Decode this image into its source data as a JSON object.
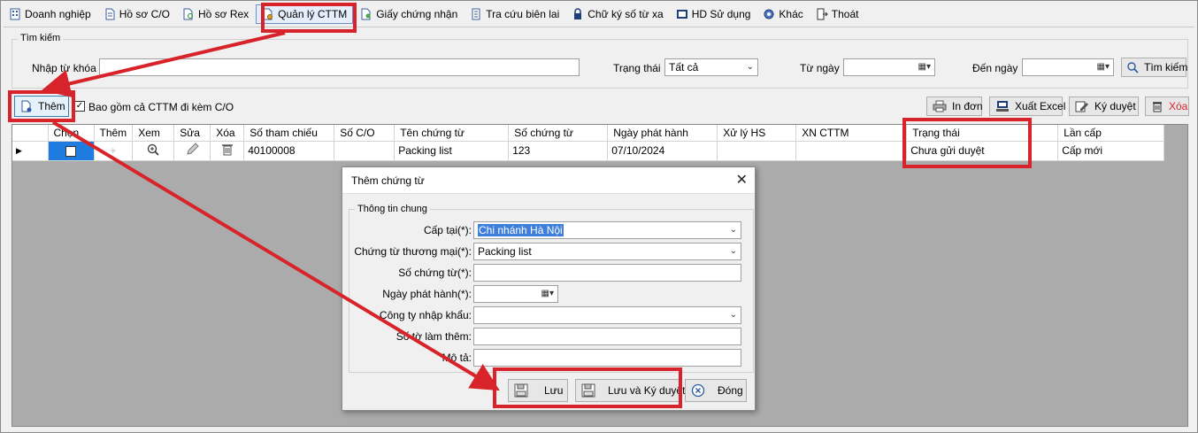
{
  "menu": {
    "items": [
      {
        "label": "Doanh nghiệp",
        "icon": "building-icon"
      },
      {
        "label": "Hồ sơ C/O",
        "icon": "document-icon"
      },
      {
        "label": "Hồ sơ Rex",
        "icon": "document-search-icon"
      },
      {
        "label": "Quản lý CTTM",
        "icon": "document-gear-icon"
      },
      {
        "label": "Giấy chứng nhận",
        "icon": "certificate-icon"
      },
      {
        "label": "Tra cứu biên lai",
        "icon": "receipt-icon"
      },
      {
        "label": "Chữ ký số từ xa",
        "icon": "lock-icon"
      },
      {
        "label": "HD Sử dụng",
        "icon": "help-icon"
      },
      {
        "label": "Khác",
        "icon": "gear-icon"
      },
      {
        "label": "Thoát",
        "icon": "exit-icon"
      }
    ]
  },
  "search": {
    "group_title": "Tìm kiếm",
    "keyword_label": "Nhập từ khóa",
    "keyword_value": "",
    "status_label": "Trạng thái",
    "status_value": "Tất cả",
    "from_label": "Từ ngày",
    "from_value": "",
    "to_label": "Đến ngày",
    "to_value": "",
    "search_button": "Tìm kiếm"
  },
  "toolbar": {
    "add_button": "Thêm",
    "include_checkbox_label": "Bao gồm cả CTTM đi kèm C/O",
    "include_checked": true,
    "print_button": "In đơn",
    "export_button": "Xuất Excel",
    "sign_button": "Ký duyệt",
    "delete_button": "Xóa"
  },
  "grid": {
    "columns": [
      "Chọn",
      "Thêm",
      "Xem",
      "Sửa",
      "Xóa",
      "Số tham chiếu",
      "Số C/O",
      "Tên chứng từ",
      "Số chứng từ",
      "Ngày phát hành",
      "Xử lý HS",
      "XN CTTM",
      "Trạng thái",
      "Lần cấp"
    ],
    "rows": [
      {
        "ref_no": "40100008",
        "co_no": "",
        "doc_name": "Packing list",
        "doc_no": "123",
        "issue_date": "07/10/2024",
        "processing": "",
        "confirm": "",
        "status": "Chưa gửi duyệt",
        "issue_count": "Cấp mới"
      }
    ]
  },
  "dialog": {
    "title": "Thêm chứng từ",
    "group_title": "Thông tin chung",
    "fields": {
      "issued_at_label": "Cấp tại(*):",
      "issued_at_value": "Chi nhánh Hà Nội",
      "commercial_doc_label": "Chứng từ thương mại(*):",
      "commercial_doc_value": "Packing list",
      "doc_no_label": "Số chứng từ(*):",
      "doc_no_value": "",
      "issue_date_label": "Ngày phát hành(*):",
      "issue_date_value": "",
      "importer_label": "Công ty nhập khẩu:",
      "importer_value": "",
      "extra_pages_label": "Số tờ làm thêm:",
      "extra_pages_value": "",
      "description_label": "Mô tả:",
      "description_value": ""
    },
    "save_button": "Lưu",
    "save_sign_button": "Lưu và Ký duyệt",
    "close_button": "Đóng"
  },
  "colors": {
    "highlight": "#d8232a",
    "selected_text_bg": "#3d7fdb",
    "selected_cell_bg": "#1e7ce0",
    "grid_background": "#ababab"
  }
}
